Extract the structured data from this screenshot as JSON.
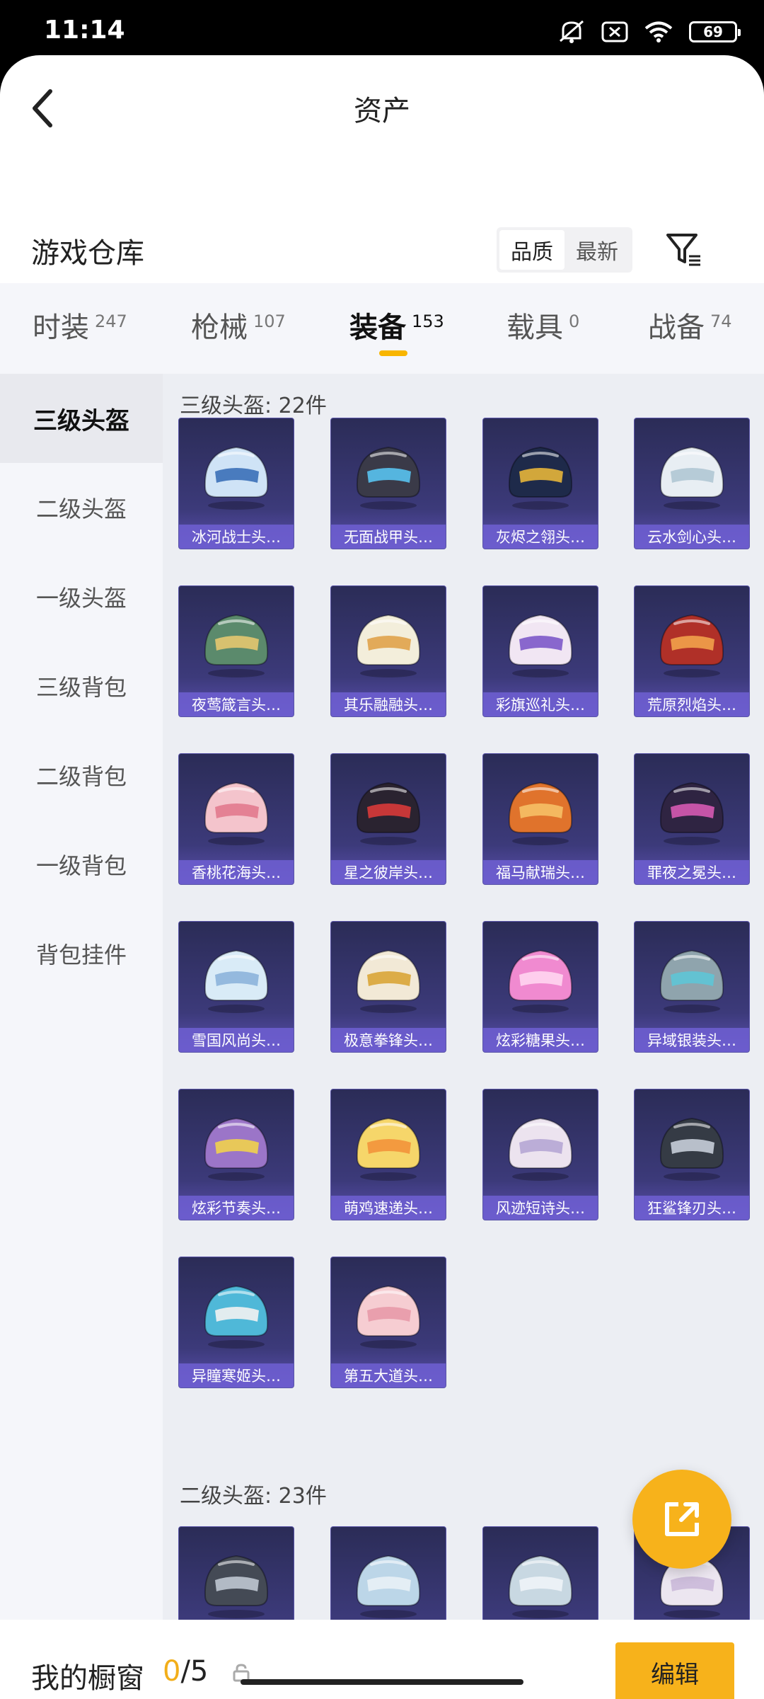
{
  "status": {
    "time": "11:14",
    "battery": "69"
  },
  "nav": {
    "title": "资产"
  },
  "warehouse": {
    "title": "游戏仓库",
    "sort_options": [
      "品质",
      "最新"
    ]
  },
  "category_tabs": [
    {
      "label": "时装",
      "count": "247"
    },
    {
      "label": "枪械",
      "count": "107"
    },
    {
      "label": "装备",
      "count": "153"
    },
    {
      "label": "载具",
      "count": "0"
    },
    {
      "label": "战备",
      "count": "74"
    }
  ],
  "sub_categories": [
    "三级头盔",
    "二级头盔",
    "一级头盔",
    "三级背包",
    "二级背包",
    "一级背包",
    "背包挂件"
  ],
  "sections": [
    {
      "title": "三级头盔: 22件",
      "items": [
        {
          "name": "冰河战士头…",
          "color": "#cfe3f6",
          "accent": "#3a6fb8"
        },
        {
          "name": "无面战甲头…",
          "color": "#3a3a48",
          "accent": "#59c3f0"
        },
        {
          "name": "灰烬之翎头…",
          "color": "#1e2a4a",
          "accent": "#e6b53a"
        },
        {
          "name": "云水剑心头…",
          "color": "#e8eef3",
          "accent": "#b0c6d4"
        },
        {
          "name": "夜莺箴言头…",
          "color": "#5b8a6c",
          "accent": "#e4c770"
        },
        {
          "name": "其乐融融头…",
          "color": "#f3eedb",
          "accent": "#e0a24a"
        },
        {
          "name": "彩旗巡礼头…",
          "color": "#f1e6f3",
          "accent": "#7d59c9"
        },
        {
          "name": "荒原烈焰头…",
          "color": "#b03028",
          "accent": "#f2a24a"
        },
        {
          "name": "香桃花海头…",
          "color": "#f4c4cc",
          "accent": "#e27a8e"
        },
        {
          "name": "星之彼岸头…",
          "color": "#2a2330",
          "accent": "#d83a3a"
        },
        {
          "name": "福马献瑞头…",
          "color": "#e0732c",
          "accent": "#f6c066"
        },
        {
          "name": "罪夜之冕头…",
          "color": "#2f2442",
          "accent": "#d65ab3"
        },
        {
          "name": "雪国风尚头…",
          "color": "#d9ebf7",
          "accent": "#8cb4da"
        },
        {
          "name": "极意拳锋头…",
          "color": "#f2e9d6",
          "accent": "#d9a537"
        },
        {
          "name": "炫彩糖果头…",
          "color": "#f08ad0",
          "accent": "#ffd5f0"
        },
        {
          "name": "异域银装头…",
          "color": "#8fa4ad",
          "accent": "#5ec5d6"
        },
        {
          "name": "炫彩节奏头…",
          "color": "#9b75c8",
          "accent": "#f1d24d"
        },
        {
          "name": "萌鸡速递头…",
          "color": "#f6d66a",
          "accent": "#f3943b"
        },
        {
          "name": "风迹短诗头…",
          "color": "#ece3ef",
          "accent": "#b6a6d4"
        },
        {
          "name": "狂鲨锋刃头…",
          "color": "#353b45",
          "accent": "#c7ced8"
        },
        {
          "name": "异瞳寒姬头…",
          "color": "#4fb8d8",
          "accent": "#f2f2f2"
        },
        {
          "name": "第五大道头…",
          "color": "#f6cdd2",
          "accent": "#e89aa8"
        }
      ]
    },
    {
      "title": "二级头盔: 23件",
      "items": [
        {
          "name": "",
          "color": "#444a55",
          "accent": "#bfc7d1"
        },
        {
          "name": "",
          "color": "#bcd6e8",
          "accent": "#e8f1f6"
        },
        {
          "name": "",
          "color": "#c8d8e2",
          "accent": "#eef4f8"
        },
        {
          "name": "",
          "color": "#ece6f0",
          "accent": "#cbb9d9"
        }
      ]
    }
  ],
  "showcase": {
    "label": "我的橱窗",
    "current": "0",
    "total": "/5",
    "edit_label": "编辑"
  }
}
